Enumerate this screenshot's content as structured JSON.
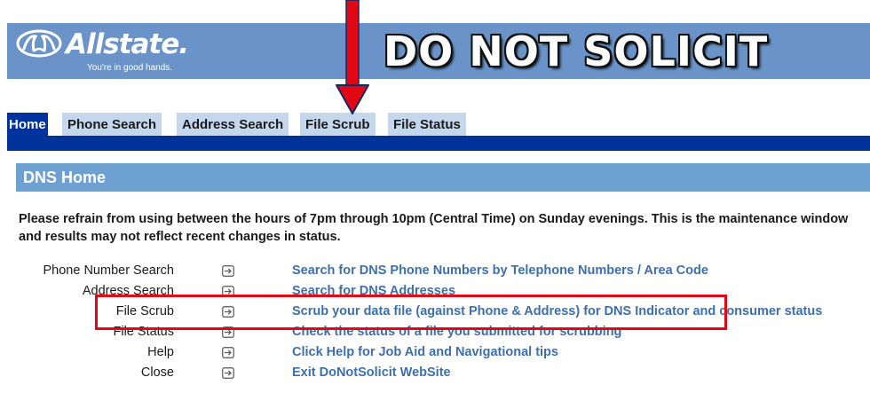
{
  "header": {
    "logo_text": "Allstate.",
    "logo_tagline": "You're in good hands.",
    "title": "DO NOT SOLICIT"
  },
  "tabs": [
    {
      "label": "Home",
      "active": true
    },
    {
      "label": "Phone Search",
      "active": false
    },
    {
      "label": "Address Search",
      "active": false
    },
    {
      "label": "File Scrub",
      "active": false
    },
    {
      "label": "File Status",
      "active": false
    }
  ],
  "section": {
    "title": "DNS Home"
  },
  "notice": "Please refrain from using between the hours of 7pm through 10pm (Central Time) on Sunday evenings. This is the maintenance window and results may not reflect recent changes in status.",
  "menu": [
    {
      "label": "Phone Number Search",
      "link": "Search for DNS Phone Numbers by Telephone Numbers / Area Code"
    },
    {
      "label": "Address Search",
      "link": "Search for DNS Addresses"
    },
    {
      "label": "File Scrub",
      "link": "Scrub your data file (against Phone & Address) for DNS Indicator and consumer status"
    },
    {
      "label": "File Status",
      "link": "Check the status of a file you submitted for scrubbing"
    },
    {
      "label": "Help",
      "link": "Click Help for Job Aid and Navigational tips"
    },
    {
      "label": "Close",
      "link": "Exit DoNotSolicit WebSite"
    }
  ],
  "icons": {
    "logo": "good-hands-icon",
    "row_arrow": "arrow-right-box-icon"
  },
  "colors": {
    "banner": "#6a94c9",
    "tab_inactive": "#c5d7ec",
    "tab_active": "#0033a0",
    "nav_rule": "#003399",
    "section_header": "#6fa0d2",
    "link": "#3d6fb0",
    "annotation": "#e30613"
  },
  "annotations": {
    "arrow_points_to": "File Scrub",
    "highlighted_row": "File Scrub"
  }
}
